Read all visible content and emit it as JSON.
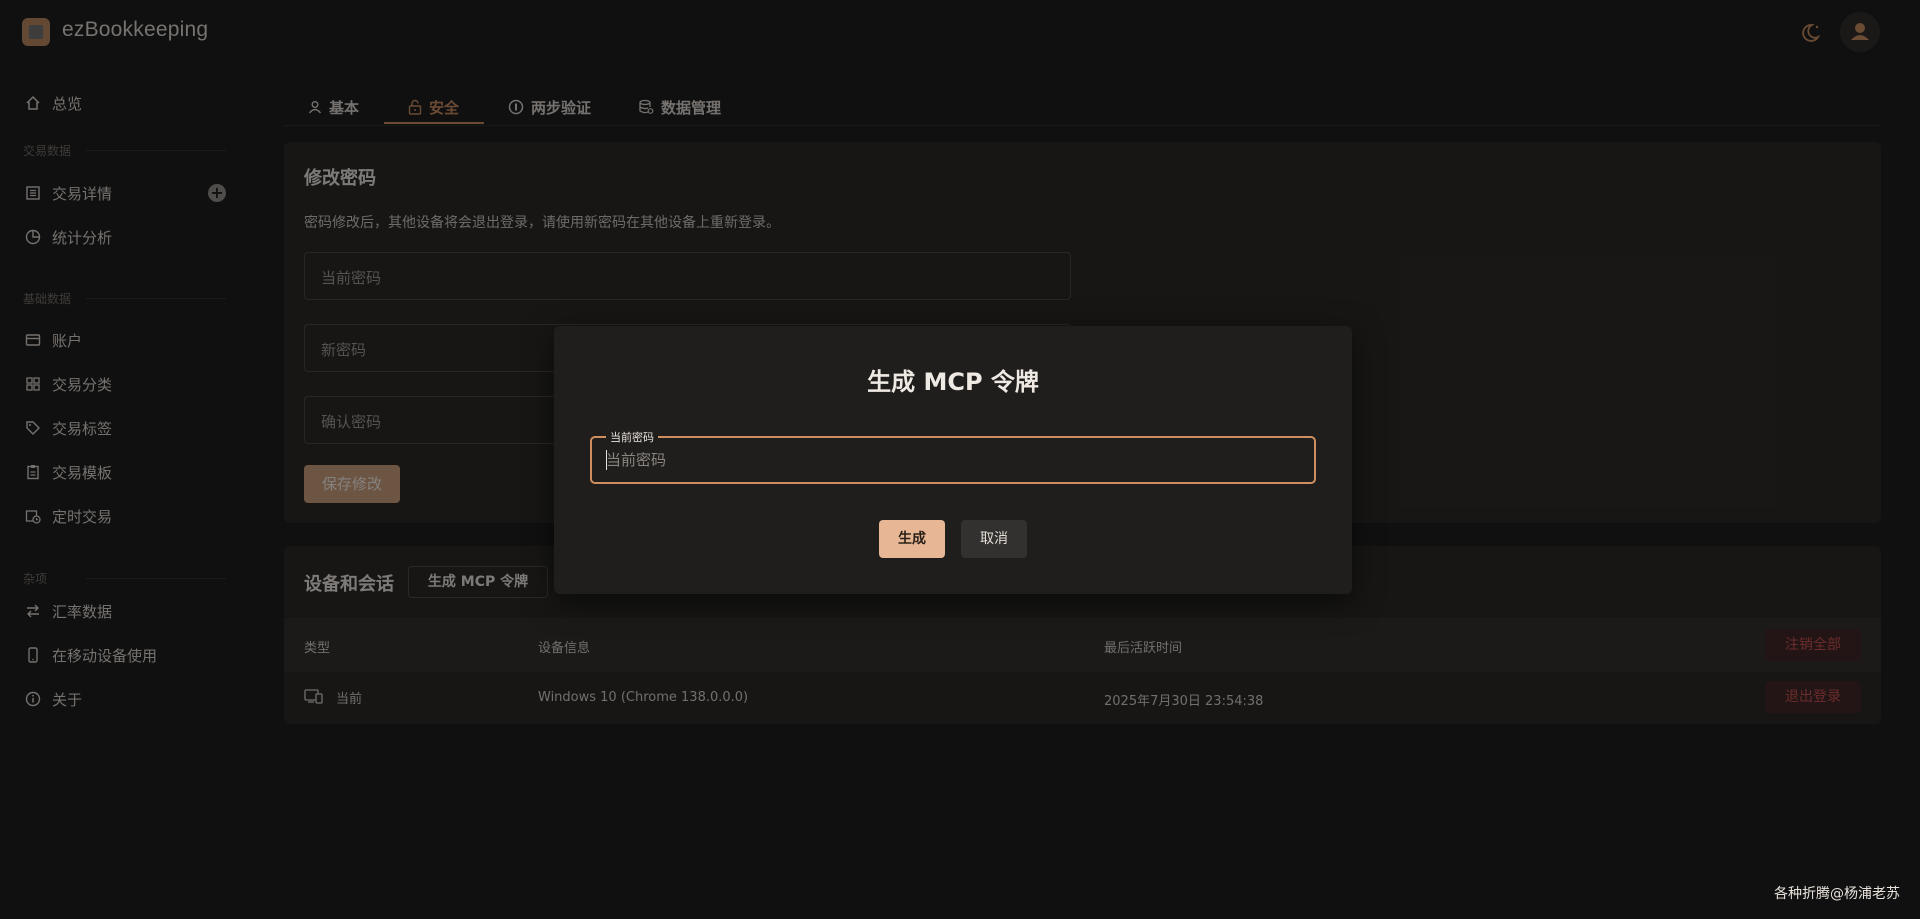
{
  "app": {
    "title": "ezBookkeeping"
  },
  "sidebar": {
    "overview": "总览",
    "section_transactions": "交易数据",
    "transaction_details": "交易详情",
    "statistics": "统计分析",
    "section_basic": "基础数据",
    "accounts": "账户",
    "categories": "交易分类",
    "tags": "交易标签",
    "templates": "交易模板",
    "scheduled": "定时交易",
    "section_misc": "杂项",
    "exchange_rates": "汇率数据",
    "mobile": "在移动设备使用",
    "about": "关于"
  },
  "tabs": {
    "basic": "基本",
    "security": "安全",
    "two_factor": "两步验证",
    "data_management": "数据管理"
  },
  "password_card": {
    "title": "修改密码",
    "description": "密码修改后，其他设备将会退出登录，请使用新密码在其他设备上重新登录。",
    "current_password": "当前密码",
    "new_password": "新密码",
    "confirm_password": "确认密码",
    "save_label": "保存修改"
  },
  "sessions_card": {
    "title": "设备和会话",
    "generate_mcp_label": "生成 MCP 令牌",
    "headers": {
      "type": "类型",
      "device_info": "设备信息",
      "last_active": "最后活跃时间"
    },
    "logout_all_label": "注销全部",
    "rows": [
      {
        "type": "当前",
        "device": "Windows 10 (Chrome 138.0.0.0)",
        "last_active": "2025年7月30日 23:54:38",
        "action": "退出登录"
      }
    ]
  },
  "dialog": {
    "title": "生成 MCP 令牌",
    "field_label": "当前密码",
    "field_placeholder": "当前密码",
    "field_value": "",
    "generate_label": "生成",
    "cancel_label": "取消"
  },
  "watermark": "各种折腾@杨浦老苏",
  "colors": {
    "accent": "#c4875b",
    "primary_button": "#e7b795",
    "danger": "#c24b4b"
  }
}
